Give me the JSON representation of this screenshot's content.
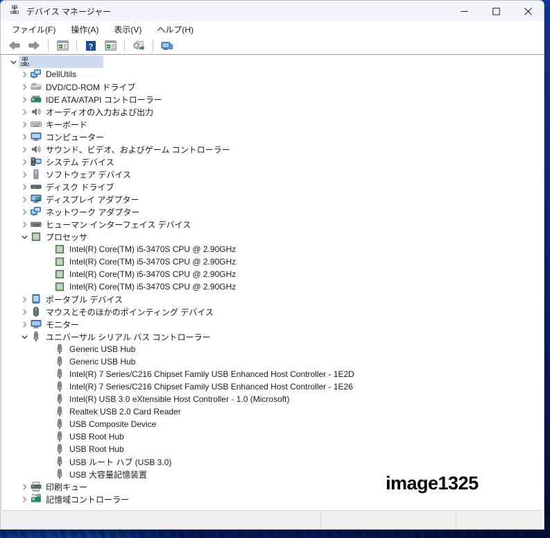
{
  "window": {
    "title": "デバイス マネージャー",
    "icon": "device-manager-icon",
    "controls": {
      "minimize": "最小化",
      "maximize": "最大化",
      "close": "閉じる"
    }
  },
  "menubar": {
    "items": [
      {
        "label": "ファイル(F)",
        "name": "menu-file"
      },
      {
        "label": "操作(A)",
        "name": "menu-action"
      },
      {
        "label": "表示(V)",
        "name": "menu-view"
      },
      {
        "label": "ヘルプ(H)",
        "name": "menu-help"
      }
    ]
  },
  "toolbar": {
    "buttons": [
      {
        "icon": "back-arrow-icon",
        "tip": "戻る"
      },
      {
        "icon": "forward-arrow-icon",
        "tip": "進む"
      },
      {
        "icon": "properties-icon",
        "tip": "プロパティ"
      },
      {
        "icon": "help-icon",
        "tip": "ヘルプ"
      },
      {
        "icon": "update-driver-icon",
        "tip": "ドライバーの更新"
      },
      {
        "icon": "scan-hardware-icon",
        "tip": "ハードウェア変更のスキャン"
      },
      {
        "icon": "display-icon",
        "tip": "表示"
      }
    ]
  },
  "tree": {
    "root": {
      "label": "",
      "icon": "computer-root-icon",
      "expanded": true,
      "selected": true
    },
    "nodes": [
      {
        "label": "DellUtils",
        "icon": "monitor-network-icon",
        "level": 1,
        "expandable": true,
        "expanded": false
      },
      {
        "label": "DVD/CD-ROM ドライブ",
        "icon": "dvd-drive-icon",
        "level": 1,
        "expandable": true,
        "expanded": false
      },
      {
        "label": "IDE ATA/ATAPI コントローラー",
        "icon": "ide-controller-icon",
        "level": 1,
        "expandable": true,
        "expanded": false
      },
      {
        "label": "オーディオの入力および出力",
        "icon": "speaker-icon",
        "level": 1,
        "expandable": true,
        "expanded": false
      },
      {
        "label": "キーボード",
        "icon": "keyboard-icon",
        "level": 1,
        "expandable": true,
        "expanded": false
      },
      {
        "label": "コンピューター",
        "icon": "computer-icon",
        "level": 1,
        "expandable": true,
        "expanded": false
      },
      {
        "label": "サウンド、ビデオ、およびゲーム コントローラー",
        "icon": "speaker-icon",
        "level": 1,
        "expandable": true,
        "expanded": false
      },
      {
        "label": "システム デバイス",
        "icon": "system-device-icon",
        "level": 1,
        "expandable": true,
        "expanded": false
      },
      {
        "label": "ソフトウェア デバイス",
        "icon": "software-device-icon",
        "level": 1,
        "expandable": true,
        "expanded": false
      },
      {
        "label": "ディスク ドライブ",
        "icon": "disk-drive-icon",
        "level": 1,
        "expandable": true,
        "expanded": false
      },
      {
        "label": "ディスプレイ アダプター",
        "icon": "display-adapter-icon",
        "level": 1,
        "expandable": true,
        "expanded": false
      },
      {
        "label": "ネットワーク アダプター",
        "icon": "network-adapter-icon",
        "level": 1,
        "expandable": true,
        "expanded": false
      },
      {
        "label": "ヒューマン インターフェイス デバイス",
        "icon": "hid-icon",
        "level": 1,
        "expandable": true,
        "expanded": false
      },
      {
        "label": "プロセッサ",
        "icon": "processor-icon",
        "level": 1,
        "expandable": true,
        "expanded": true
      },
      {
        "label": "Intel(R) Core(TM) i5-3470S CPU @ 2.90GHz",
        "icon": "processor-icon",
        "level": 2,
        "expandable": false
      },
      {
        "label": "Intel(R) Core(TM) i5-3470S CPU @ 2.90GHz",
        "icon": "processor-icon",
        "level": 2,
        "expandable": false
      },
      {
        "label": "Intel(R) Core(TM) i5-3470S CPU @ 2.90GHz",
        "icon": "processor-icon",
        "level": 2,
        "expandable": false
      },
      {
        "label": "Intel(R) Core(TM) i5-3470S CPU @ 2.90GHz",
        "icon": "processor-icon",
        "level": 2,
        "expandable": false
      },
      {
        "label": "ポータブル デバイス",
        "icon": "portable-device-icon",
        "level": 1,
        "expandable": true,
        "expanded": false
      },
      {
        "label": "マウスとそのほかのポインティング デバイス",
        "icon": "mouse-icon",
        "level": 1,
        "expandable": true,
        "expanded": false
      },
      {
        "label": "モニター",
        "icon": "monitor-icon",
        "level": 1,
        "expandable": true,
        "expanded": false
      },
      {
        "label": "ユニバーサル シリアル バス コントローラー",
        "icon": "usb-icon",
        "level": 1,
        "expandable": true,
        "expanded": true
      },
      {
        "label": "Generic USB Hub",
        "icon": "usb-icon",
        "level": 2,
        "expandable": false
      },
      {
        "label": "Generic USB Hub",
        "icon": "usb-icon",
        "level": 2,
        "expandable": false
      },
      {
        "label": "Intel(R) 7 Series/C216 Chipset Family USB Enhanced Host Controller - 1E2D",
        "icon": "usb-icon",
        "level": 2,
        "expandable": false
      },
      {
        "label": "Intel(R) 7 Series/C216 Chipset Family USB Enhanced Host Controller - 1E26",
        "icon": "usb-icon",
        "level": 2,
        "expandable": false
      },
      {
        "label": "Intel(R) USB 3.0 eXtensible Host Controller - 1.0 (Microsoft)",
        "icon": "usb-icon",
        "level": 2,
        "expandable": false
      },
      {
        "label": "Realtek USB 2.0 Card Reader",
        "icon": "usb-icon",
        "level": 2,
        "expandable": false
      },
      {
        "label": "USB Composite Device",
        "icon": "usb-icon",
        "level": 2,
        "expandable": false
      },
      {
        "label": "USB Root Hub",
        "icon": "usb-icon",
        "level": 2,
        "expandable": false
      },
      {
        "label": "USB Root Hub",
        "icon": "usb-icon",
        "level": 2,
        "expandable": false
      },
      {
        "label": "USB ルート ハブ (USB 3.0)",
        "icon": "usb-icon",
        "level": 2,
        "expandable": false
      },
      {
        "label": "USB 大容量記憶装置",
        "icon": "usb-icon",
        "level": 2,
        "expandable": false
      },
      {
        "label": "印刷キュー",
        "icon": "printer-icon",
        "level": 1,
        "expandable": true,
        "expanded": false
      },
      {
        "label": "記憶域コントローラー",
        "icon": "storage-controller-icon",
        "level": 1,
        "expandable": true,
        "expanded": false
      }
    ]
  },
  "watermark": {
    "text": "image1325"
  },
  "statusbar": {
    "segment1": "",
    "segment2": "",
    "segment3": ""
  },
  "colors": {
    "selection": "#cfdcef",
    "titlebar": "#f3f5f9",
    "statusbar": "#f0f0f0",
    "text": "#1b1b1b",
    "accent_blue": "#0f6cbd"
  }
}
